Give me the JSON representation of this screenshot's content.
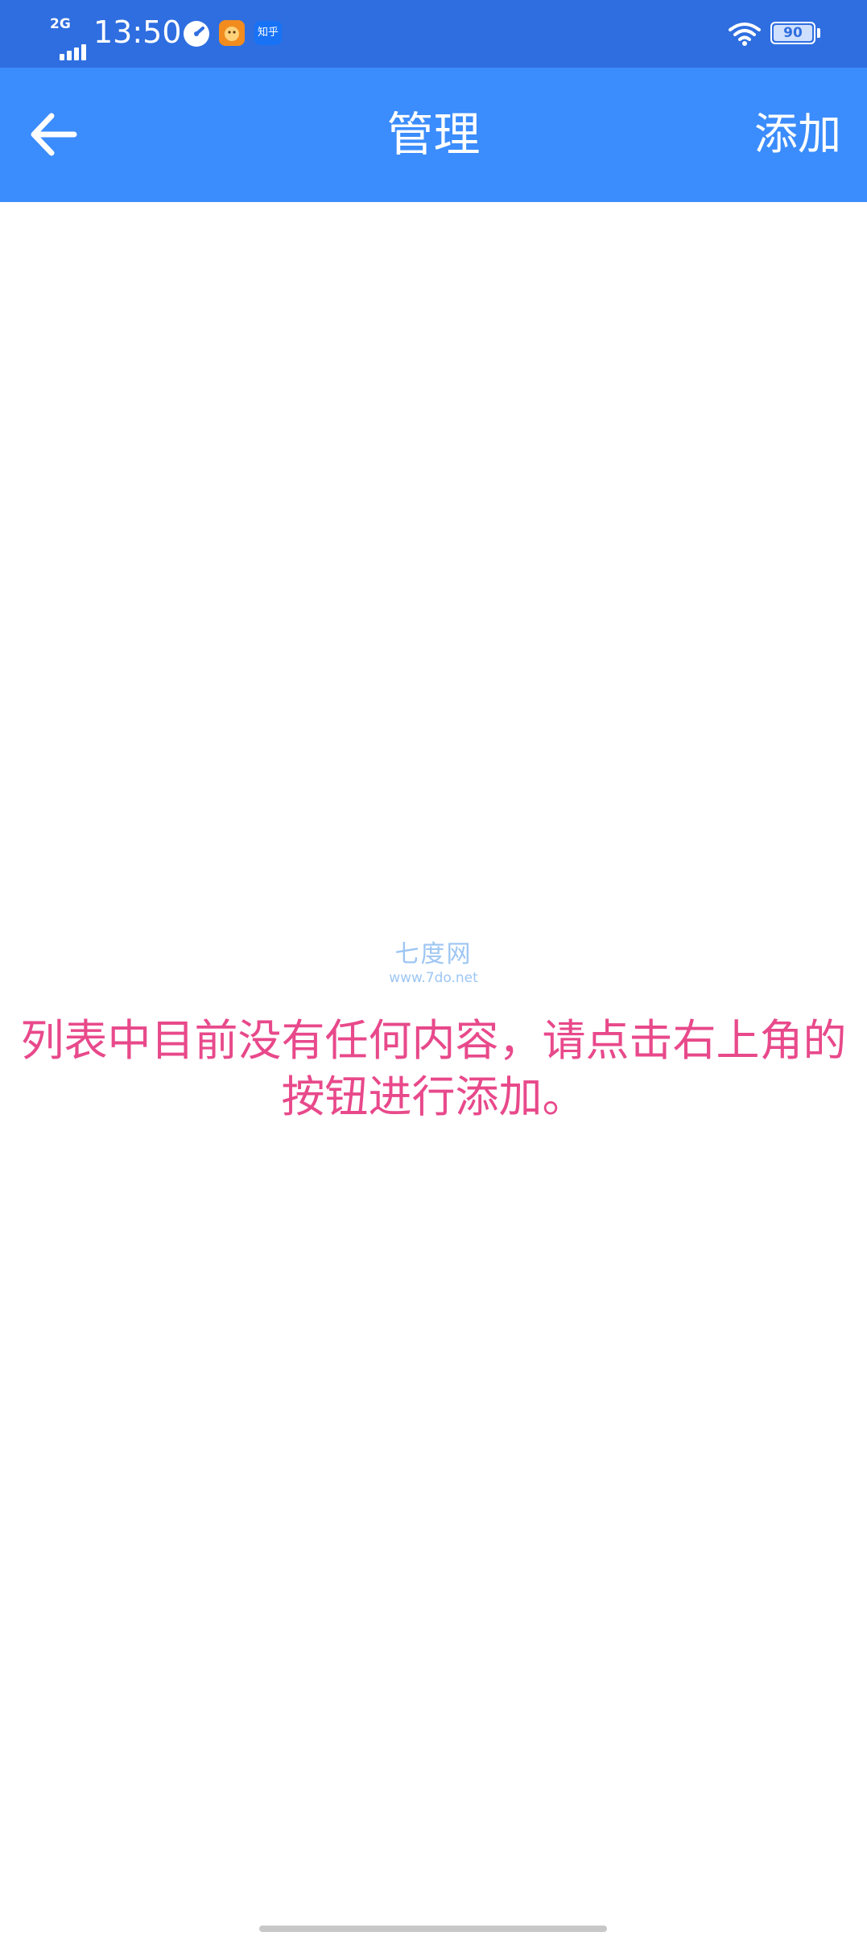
{
  "status_bar": {
    "network_type": "2G",
    "time": "13:50",
    "notification_app_label": "知乎",
    "battery_level": "90",
    "background_color": "#2f6ee0"
  },
  "app_bar": {
    "title": "管理",
    "add_label": "添加",
    "back_icon": "arrow-left-icon",
    "background_color": "#3b8cfc"
  },
  "watermark": {
    "logo_text": "七度网",
    "url_text": "www.7do.net"
  },
  "empty_state": {
    "message": "列表中目前没有任何内容，请点击右上角的按钮进行添加。",
    "color": "#e8498b"
  }
}
